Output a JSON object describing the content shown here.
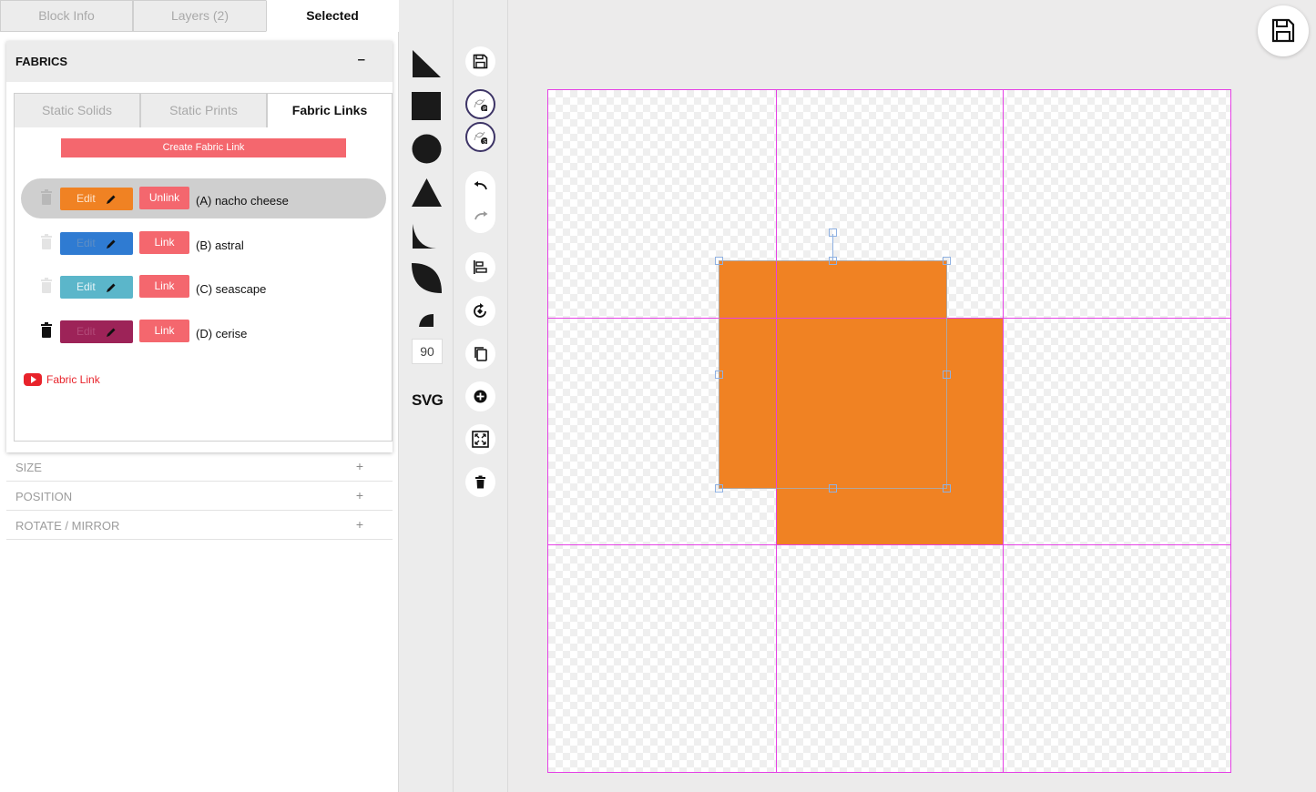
{
  "top_tabs": [
    {
      "label": "Block Info",
      "active": false
    },
    {
      "label": "Layers (2)",
      "active": false
    },
    {
      "label": "Selected",
      "active": true
    }
  ],
  "fabrics": {
    "title": "FABRICS",
    "collapse_symbol": "–",
    "tabs": [
      {
        "label": "Static Solids",
        "active": false
      },
      {
        "label": "Static Prints",
        "active": false
      },
      {
        "label": "Fabric Links",
        "active": true
      }
    ],
    "create_button": "Create Fabric Link",
    "links": [
      {
        "name": "(A) nacho cheese",
        "edit_label": "Edit",
        "link_label": "Unlink",
        "color": "#f08223",
        "selected": true,
        "trash_enabled": false
      },
      {
        "name": "(B) astral",
        "edit_label": "Edit",
        "link_label": "Link",
        "color": "#2f7bd2",
        "selected": false,
        "trash_enabled": false
      },
      {
        "name": "(C) seascape",
        "edit_label": "Edit",
        "link_label": "Link",
        "color": "#5bb6ca",
        "selected": false,
        "trash_enabled": false
      },
      {
        "name": "(D) cerise",
        "edit_label": "Edit",
        "link_label": "Link",
        "color": "#9d2358",
        "selected": false,
        "trash_enabled": true
      }
    ],
    "help_link": "Fabric Link"
  },
  "sections": [
    {
      "label": "SIZE",
      "symbol": "+"
    },
    {
      "label": "POSITION",
      "symbol": "+"
    },
    {
      "label": "ROTATE / MIRROR",
      "symbol": "+"
    }
  ],
  "shape_tools": {
    "shapes": [
      "right-triangle-icon",
      "square-icon",
      "circle-icon",
      "triangle-icon",
      "concave-corner-icon",
      "leaf-icon",
      "quarter-circle-icon"
    ],
    "angle_value": "90",
    "svg_label": "SVG"
  },
  "tool_buttons": [
    "save-icon",
    "fabric-p-icon",
    "fabric-s-icon",
    "undo-icon",
    "redo-icon",
    "align-icon",
    "rotate-icon",
    "copy-icon",
    "add-icon",
    "fit-icon",
    "delete-icon"
  ],
  "canvas": {
    "grid": "3x3",
    "fill_color": "#f08223",
    "guide_color": "#e541e5"
  }
}
